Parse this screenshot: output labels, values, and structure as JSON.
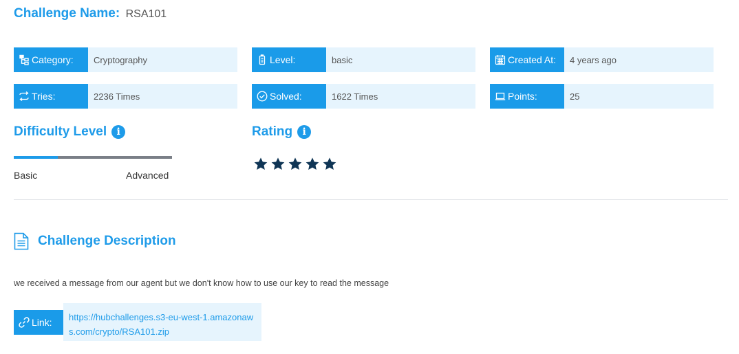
{
  "challenge": {
    "name_label": "Challenge Name:",
    "name": "RSA101"
  },
  "info": {
    "category": {
      "label": "Category:",
      "value": "Cryptography",
      "icon": "sitemap-icon"
    },
    "level": {
      "label": "Level:",
      "value": "basic",
      "icon": "battery-icon"
    },
    "created": {
      "label": "Created At:",
      "value": "4 years ago",
      "icon": "calendar-icon"
    },
    "tries": {
      "label": "Tries:",
      "value": "2236 Times",
      "icon": "exchange-icon"
    },
    "solved": {
      "label": "Solved:",
      "value": "1622 Times",
      "icon": "check-circle-icon"
    },
    "points": {
      "label": "Points:",
      "value": "25",
      "icon": "laptop-icon"
    }
  },
  "difficulty": {
    "title": "Difficulty Level",
    "min_label": "Basic",
    "max_label": "Advanced",
    "level_fraction": 0.28
  },
  "rating": {
    "title": "Rating",
    "stars": 5,
    "max_stars": 5
  },
  "description": {
    "title": "Challenge Description",
    "text": "we received a message from our agent but we don't know how to use our key to read the message"
  },
  "link": {
    "label": "Link:",
    "url": "https://hubchallenges.s3-eu-west-1.amazonaws.com/crypto/RSA101.zip"
  },
  "colors": {
    "accent": "#1e9be9",
    "value_bg": "#e6f4fd",
    "star": "#0f3555",
    "track": "#7a7f87"
  }
}
